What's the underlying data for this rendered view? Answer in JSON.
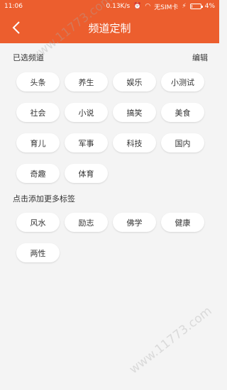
{
  "status": {
    "time": "11:06",
    "speed": "0.13K/s",
    "sim": "无SIM卡",
    "battery": "4%"
  },
  "header": {
    "title": "频道定制"
  },
  "selected": {
    "label": "已选频道",
    "edit": "编辑",
    "chips": [
      "头条",
      "养生",
      "娱乐",
      "小测试",
      "社会",
      "小说",
      "搞笑",
      "美食",
      "育儿",
      "军事",
      "科技",
      "国内",
      "奇趣",
      "体育"
    ]
  },
  "more": {
    "label": "点击添加更多标签",
    "chips": [
      "风水",
      "励志",
      "佛学",
      "健康",
      "两性"
    ]
  },
  "watermark": "www.11773.com"
}
